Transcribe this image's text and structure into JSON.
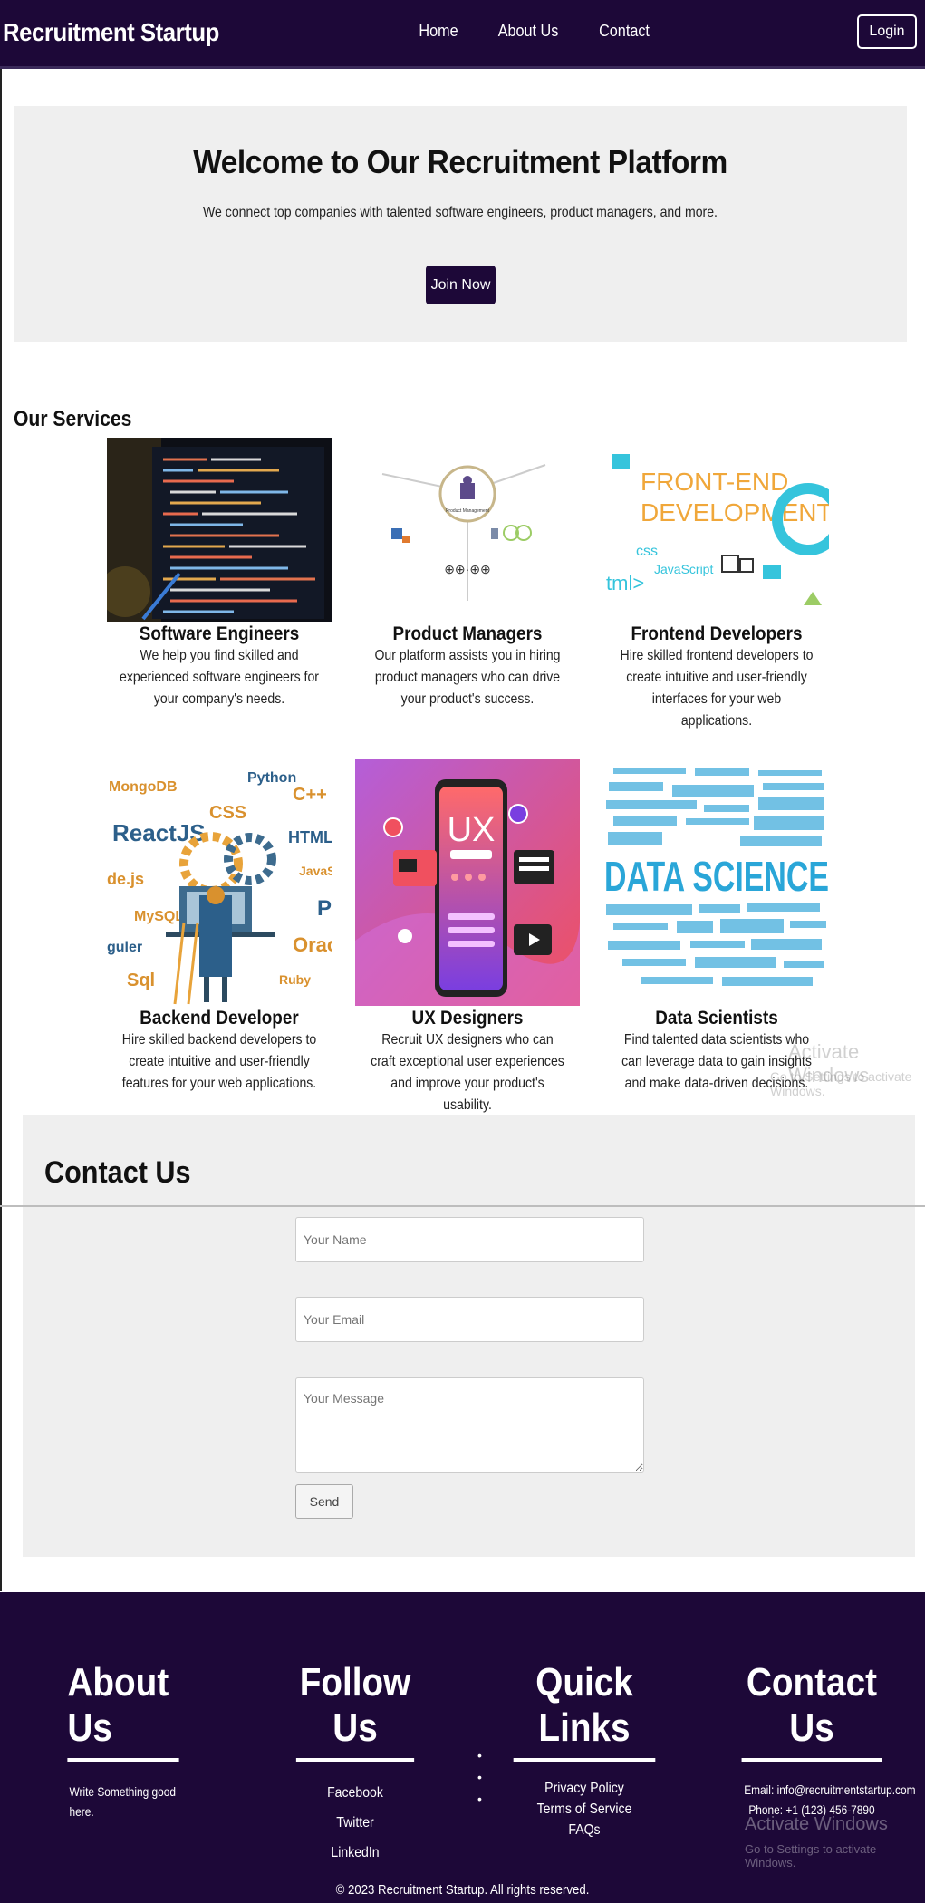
{
  "navbar": {
    "brand": "Recruitment Startup",
    "links": [
      "Home",
      "About Us",
      "Contact"
    ],
    "login_label": "Login"
  },
  "hero": {
    "title": "Welcome to Our Recruitment Platform",
    "subtitle": "We connect top companies with talented software engineers, product managers, and more.",
    "cta_label": "Join Now"
  },
  "services": {
    "title": "Our Services",
    "items": [
      {
        "title": "Software Engineers",
        "desc": "We help you find skilled and experienced software engineers for your company's needs."
      },
      {
        "title": "Product Managers",
        "desc": "Our platform assists you in hiring product managers who can drive your product's success."
      },
      {
        "title": "Frontend Developers",
        "desc": "Hire skilled frontend developers to create intuitive and user-friendly interfaces for your web applications."
      },
      {
        "title": "Backend Developer",
        "desc": "Hire skilled backend developers to create intuitive and user-friendly features for your web applications."
      },
      {
        "title": "UX Designers",
        "desc": "Recruit UX designers who can craft exceptional user experiences and improve your product's usability."
      },
      {
        "title": "Data Scientists",
        "desc": "Find talented data scientists who can leverage data to gain insights and make data-driven decisions."
      }
    ],
    "images": {
      "frontend_line1": "FRONT-END",
      "frontend_line2": "DEVELOPMENT",
      "ux_label": "UX",
      "data_science": "DATA SCIENCE",
      "pm_center": "Product Management",
      "backend_words": [
        "MongoDB",
        "Python",
        "CSS",
        "C++",
        "ReactJS",
        "HTML",
        "de.js",
        "JavaS",
        "MySQL",
        "PI",
        "guler",
        "Oracl",
        "Sql",
        "Ruby"
      ]
    }
  },
  "contact": {
    "title": "Contact Us",
    "name_placeholder": "Your Name",
    "email_placeholder": "Your Email",
    "message_placeholder": "Your Message",
    "send_label": "Send"
  },
  "footer": {
    "about": {
      "title": "About Us",
      "text": "Write Something good here."
    },
    "follow": {
      "title": "Follow Us",
      "links": [
        "Facebook",
        "Twitter",
        "LinkedIn"
      ]
    },
    "quick": {
      "title": "Quick Links",
      "links": [
        "Privacy Policy",
        "Terms of Service",
        "FAQs"
      ]
    },
    "contact": {
      "title": "Contact Us",
      "email": "Email: info@recruitmentstartup.com",
      "phone": "Phone: +1 (123) 456-7890"
    },
    "copyright": "© 2023 Recruitment Startup. All rights reserved."
  },
  "watermark": {
    "line1": "Activate Windows",
    "line2": "Go to Settings to activate Windows."
  }
}
